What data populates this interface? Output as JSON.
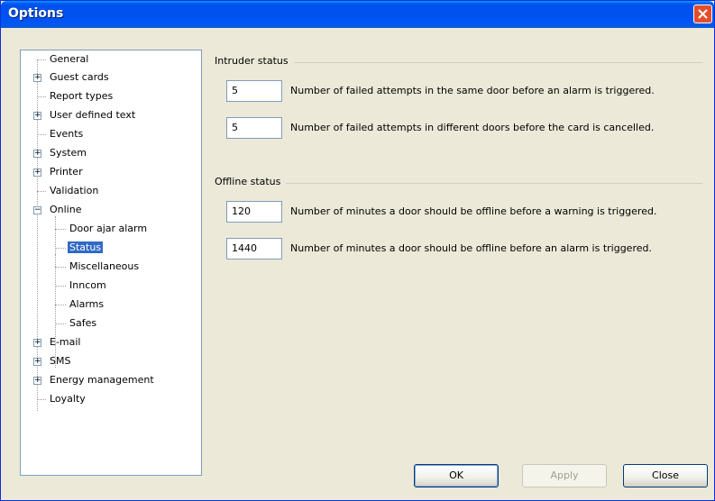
{
  "window": {
    "title": "Options"
  },
  "tree": {
    "items": [
      {
        "label": "General"
      },
      {
        "label": "Guest cards"
      },
      {
        "label": "Report types"
      },
      {
        "label": "User defined text"
      },
      {
        "label": "Events"
      },
      {
        "label": "System"
      },
      {
        "label": "Printer"
      },
      {
        "label": "Validation"
      },
      {
        "label": "Online"
      },
      {
        "label": "Door ajar alarm"
      },
      {
        "label": "Status"
      },
      {
        "label": "Miscellaneous"
      },
      {
        "label": "Inncom"
      },
      {
        "label": "Alarms"
      },
      {
        "label": "Safes"
      },
      {
        "label": "E-mail"
      },
      {
        "label": "SMS"
      },
      {
        "label": "Energy management"
      },
      {
        "label": "Loyalty"
      }
    ],
    "selected": "Status"
  },
  "intruder": {
    "title": "Intruder status",
    "rows": [
      {
        "value": "5",
        "desc": "Number of failed attempts in the same door before an alarm is triggered."
      },
      {
        "value": "5",
        "desc": "Number of failed attempts in different doors before the card is cancelled."
      }
    ]
  },
  "offline": {
    "title": "Offline status",
    "rows": [
      {
        "value": "120",
        "desc": "Number of minutes a door should be offline before a warning is triggered."
      },
      {
        "value": "1440",
        "desc": "Number of minutes a door should be offline before an alarm is triggered."
      }
    ]
  },
  "buttons": {
    "ok": "OK",
    "apply": "Apply",
    "close": "Close"
  }
}
